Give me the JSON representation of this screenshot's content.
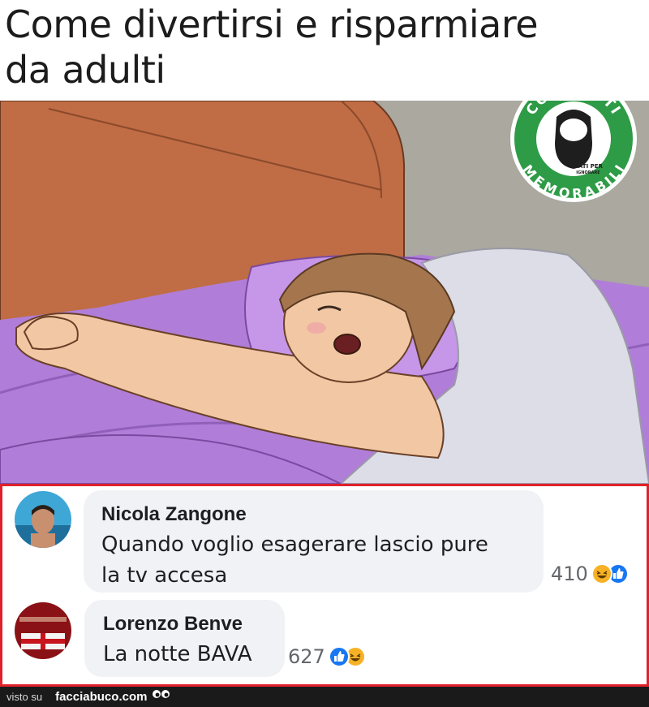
{
  "meme": {
    "title_line1": "Come divertirsi e risparmiare",
    "title_line2": "da adulti"
  },
  "watermark": {
    "top_text": "COMMENTI",
    "bottom_text": "MEMORABILI",
    "tagline_line1": "NATI PER",
    "tagline_line2": "IGNORARE",
    "trademark": "TM",
    "color": "#2e9b46"
  },
  "comments": [
    {
      "author": "Nicola Zangone",
      "text_line1": "Quando voglio esagerare lascio pure",
      "text_line2": "la tv accesa",
      "reaction_count": "410",
      "reactions": [
        "haha-icon",
        "like-icon"
      ]
    },
    {
      "author": "Lorenzo Benve",
      "text_line1": "La notte BAVA",
      "reaction_count": "627",
      "reactions": [
        "like-icon",
        "haha-icon"
      ]
    }
  ],
  "footer": {
    "visto_su": "visto su",
    "site": "facciabuco.com"
  },
  "colors": {
    "comment_border": "#e0212b",
    "bubble_bg": "#f0f2f5",
    "like_blue": "#1877f2",
    "haha_yellow": "#f7b125"
  }
}
